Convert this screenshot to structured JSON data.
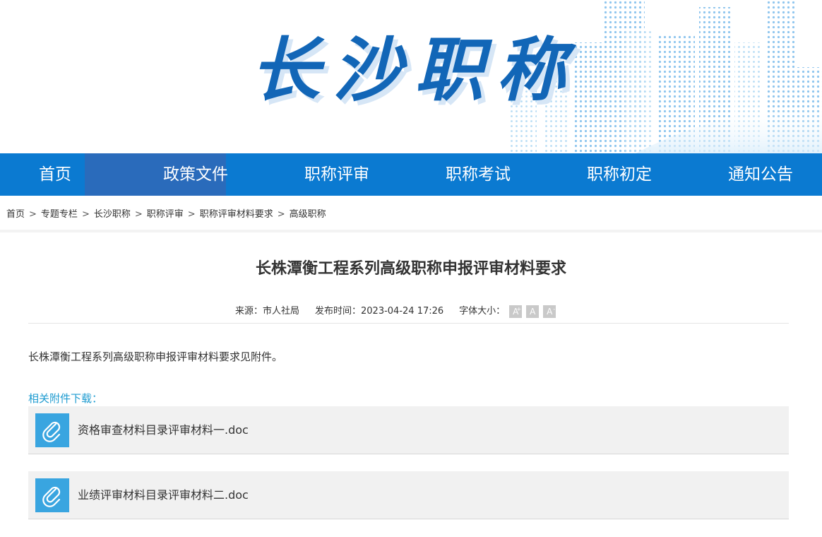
{
  "site": {
    "banner_title": "长沙职称"
  },
  "nav": {
    "items": [
      {
        "label": "首页"
      },
      {
        "label": "政策文件"
      },
      {
        "label": "职称评审"
      },
      {
        "label": "职称考试"
      },
      {
        "label": "职称初定"
      },
      {
        "label": "通知公告"
      }
    ],
    "active_index": 1
  },
  "breadcrumb": [
    "首页",
    "专题专栏",
    "长沙职称",
    "职称评审",
    "职称评审材料要求",
    "高级职称"
  ],
  "breadcrumb_separator": ">",
  "article": {
    "title": "长株潭衡工程系列高级职称申报评审材料要求",
    "source": "来源：市人社局",
    "publish": "发布时间：2023-04-24 17:26",
    "font_size_label": "字体大小：",
    "font_size_buttons": [
      "A",
      "A",
      "A"
    ],
    "font_size_button_marks": [
      "+",
      "",
      "-"
    ],
    "body": "长株潭衡工程系列高级职称申报评审材料要求见附件。",
    "attachments_label": "相关附件下载：",
    "attachments": [
      {
        "name": "资格审查材料目录评审材料一.doc",
        "icon": "paperclip-icon"
      },
      {
        "name": "业绩评审材料目录评审材料二.doc",
        "icon": "paperclip-icon"
      }
    ]
  },
  "colors": {
    "nav_bg": "#0b7ad1",
    "nav_active": "#2a6bbb",
    "brand_title": "#1266b7",
    "attachment_label": "#1e9bd0",
    "attachment_icon_bg": "#39a5e0"
  }
}
